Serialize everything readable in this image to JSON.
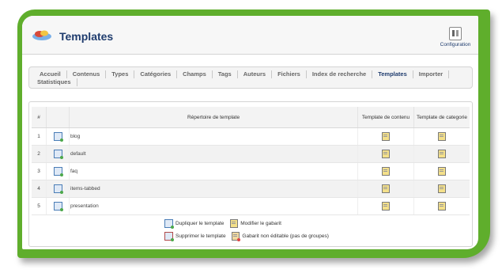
{
  "header": {
    "title": "Templates",
    "config_label": "Configuration",
    "config_icon": "configuration-icon"
  },
  "tabs": [
    {
      "label": "Accueil"
    },
    {
      "label": "Contenus"
    },
    {
      "label": "Types"
    },
    {
      "label": "Catégories"
    },
    {
      "label": "Champs"
    },
    {
      "label": "Tags"
    },
    {
      "label": "Auteurs"
    },
    {
      "label": "Fichiers"
    },
    {
      "label": "Index de recherche"
    },
    {
      "label": "Templates",
      "active": true
    },
    {
      "label": "Importer"
    },
    {
      "label": "Statistiques"
    }
  ],
  "table": {
    "columns": [
      "#",
      "",
      "Répertoire de template",
      "Template de contenu",
      "Template de categorie"
    ],
    "rows": [
      {
        "num": "1",
        "name": "blog"
      },
      {
        "num": "2",
        "name": "default"
      },
      {
        "num": "3",
        "name": "faq"
      },
      {
        "num": "4",
        "name": "items-tabbed"
      },
      {
        "num": "5",
        "name": "presentation"
      }
    ]
  },
  "legend": {
    "duplicate": "Dupliquer le template",
    "edit": "Modifier le gabarit",
    "delete": "Supprimer le template",
    "noneditable": "Gabarit non éditable (pas de groupes)"
  },
  "colors": {
    "frame_green": "#5fae2c",
    "title_blue": "#1f3c6e"
  }
}
